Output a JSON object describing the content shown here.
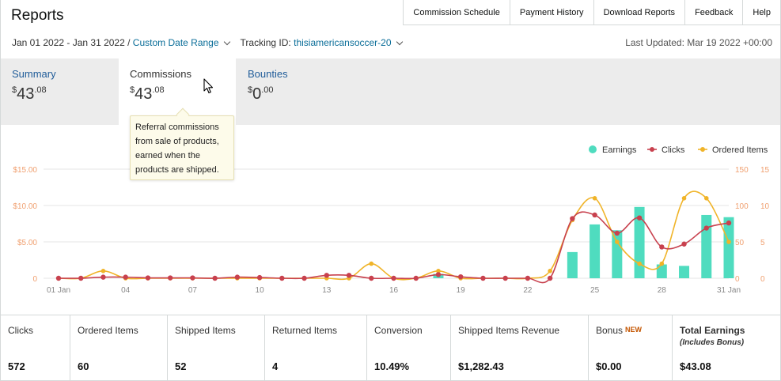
{
  "header": {
    "title": "Reports",
    "nav": [
      "Commission Schedule",
      "Payment History",
      "Download Reports",
      "Feedback",
      "Help"
    ]
  },
  "filters": {
    "date_range": "Jan 01 2022 - Jan 31 2022 /",
    "custom_range": "Custom Date Range",
    "tracking_label": "Tracking ID:",
    "tracking_id": "thisiamericansoccer-20",
    "last_updated": "Last Updated: Mar 19 2022 +00:00"
  },
  "tabs": [
    {
      "label": "Summary",
      "currency": "$",
      "whole": "43",
      "cents": ".08",
      "active": false
    },
    {
      "label": "Commissions",
      "currency": "$",
      "whole": "43",
      "cents": ".08",
      "active": true
    },
    {
      "label": "Bounties",
      "currency": "$",
      "whole": "0",
      "cents": ".00",
      "active": false
    }
  ],
  "tooltip": {
    "lines": [
      "Referral commissions",
      "from sale of products,",
      "earned when the",
      "products are shipped."
    ]
  },
  "chart_data": {
    "type": "bar",
    "legend_position": "top-right",
    "grid": true,
    "x": [
      "01 Jan",
      "02",
      "03",
      "04",
      "05",
      "06",
      "07",
      "08",
      "09",
      "10",
      "11",
      "12",
      "13",
      "14",
      "15",
      "16",
      "17",
      "18",
      "19",
      "20",
      "21",
      "22",
      "23",
      "24",
      "25",
      "26",
      "27",
      "28",
      "29",
      "30",
      "31 Jan"
    ],
    "x_tick_labels": [
      "01 Jan",
      "04",
      "07",
      "10",
      "13",
      "16",
      "19",
      "22",
      "25",
      "28",
      "31 Jan"
    ],
    "x_tick_positions": [
      1,
      4,
      7,
      10,
      13,
      16,
      19,
      22,
      25,
      28,
      31
    ],
    "series": [
      {
        "name": "Earnings",
        "type": "bar",
        "color": "#4fdcbf",
        "axis": "left",
        "values": [
          0,
          0,
          0,
          0,
          0,
          0,
          0,
          0,
          0,
          0,
          0,
          0,
          0,
          0,
          0,
          0,
          0,
          0.6,
          0,
          0,
          0,
          0,
          0,
          3.6,
          7.4,
          6.6,
          9.8,
          1.9,
          1.7,
          8.7,
          8.4
        ]
      },
      {
        "name": "Clicks",
        "type": "line",
        "color": "#c8414e",
        "axis": "right_outer",
        "values": [
          0,
          0,
          1.5,
          1.5,
          0.5,
          0.5,
          0.5,
          0,
          1.5,
          1,
          0,
          0,
          4,
          4,
          0,
          0,
          0,
          5,
          2,
          0,
          0,
          0,
          0,
          82,
          87,
          62,
          83,
          43,
          47,
          69,
          76
        ]
      },
      {
        "name": "Ordered Items",
        "type": "line",
        "color": "#f0b429",
        "axis": "right_inner",
        "values": [
          0,
          0,
          1,
          0,
          0,
          0,
          0,
          0,
          0,
          0,
          0,
          0,
          0,
          0,
          2,
          0,
          0,
          1,
          0,
          0,
          0,
          0,
          1,
          8,
          11,
          5,
          2,
          2,
          11,
          11,
          5
        ]
      }
    ],
    "axes": {
      "left": {
        "ticks": [
          "0",
          "$5.00",
          "$10.00",
          "$15.00"
        ],
        "range": [
          0,
          15
        ]
      },
      "right_outer": {
        "ticks": [
          "0",
          "50",
          "100",
          "150"
        ],
        "range": [
          0,
          150
        ]
      },
      "right_inner": {
        "ticks": [
          "0",
          "5",
          "10",
          "15"
        ],
        "range": [
          0,
          15
        ]
      }
    }
  },
  "stats": [
    {
      "label": "Clicks",
      "value": "572"
    },
    {
      "label": "Ordered Items",
      "value": "60"
    },
    {
      "label": "Shipped Items",
      "value": "52"
    },
    {
      "label": "Returned Items",
      "value": "4"
    },
    {
      "label": "Conversion",
      "value": "10.49%"
    },
    {
      "label": "Shipped Items Revenue",
      "value": "$1,282.43"
    },
    {
      "label": "Bonus",
      "badge": "NEW",
      "value": "$0.00"
    },
    {
      "label": "Total Earnings",
      "sub": "(Includes Bonus)",
      "value": "$43.08"
    }
  ],
  "colors": {
    "link": "#0b6e99",
    "tab_label": "#1f5c99",
    "earnings": "#4fdcbf",
    "clicks": "#c8414e",
    "ordered": "#f0b429",
    "axis_tick": "#f0a070",
    "bonus_badge": "#c45500"
  }
}
